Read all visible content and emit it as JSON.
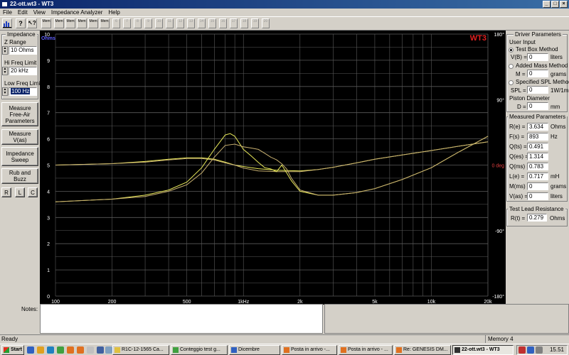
{
  "window": {
    "title": "22-ott.wt3 - WT3"
  },
  "menu": [
    "File",
    "Edit",
    "View",
    "Impedance Analyzer",
    "Help"
  ],
  "toolbar": {
    "buttons": [
      "chart-icon",
      "help-icon",
      "whats-this-icon",
      "Mem",
      "Mem",
      "Mem",
      "Mem",
      "Mem",
      "Peak",
      "Mem"
    ],
    "mem_numbers": [
      "1",
      "2",
      "3",
      "4",
      "5",
      "6",
      "7",
      "8",
      "9",
      "10",
      "11",
      "12",
      "13",
      "14",
      "15",
      "16",
      "17",
      "18",
      "19",
      "20"
    ]
  },
  "left_panel": {
    "impedance_group": "Impedance",
    "z_range_label": "Z Range",
    "z_range_value": "10 Ohms",
    "hi_freq_label": "Hi Freq Limit",
    "hi_freq_value": "20 kHz",
    "low_freq_label": "Low Freq Limit",
    "low_freq_value": "100 Hz",
    "measure_free_air": "Measure Free-Air Parameters",
    "measure_vas": "Measure V(as)",
    "impedance_sweep": "Impedance Sweep",
    "rub_and_buzz": "Rub and Buzz",
    "channel_buttons": [
      "R",
      "L",
      "C"
    ]
  },
  "graph": {
    "brand": "WT3",
    "y_unit": "Ohms",
    "y_ticks": [
      "10",
      "9",
      "8",
      "7",
      "6",
      "5",
      "4",
      "3",
      "2",
      "1",
      "0"
    ],
    "phase_ticks": [
      "180°",
      "90°",
      "0 deg",
      "-90°",
      "-180°"
    ],
    "x_ticks": [
      "100",
      "200",
      "500",
      "1kHz",
      "2k",
      "5k",
      "10k",
      "20k"
    ],
    "colors": {
      "background": "#000000",
      "grid": "#5a5a5a",
      "curve": "#e8e85a",
      "curve2": "#c8b070",
      "brand": "#e02020"
    }
  },
  "chart_data": {
    "type": "line",
    "x_scale": "log",
    "xlim": [
      100,
      20000
    ],
    "ylim": [
      0,
      10
    ],
    "y2lim": [
      -180,
      180
    ],
    "series": [
      {
        "x": [
          100,
          200,
          300,
          400,
          500,
          600,
          700,
          800,
          850,
          900,
          1000,
          1100,
          1200,
          1300,
          1400,
          1500,
          1600,
          1700,
          1800,
          2000,
          2500,
          3000,
          4000,
          5000,
          7000,
          10000,
          14000,
          20000
        ],
        "y": [
          3.6,
          3.7,
          3.85,
          4.05,
          4.35,
          4.9,
          5.6,
          6.15,
          6.2,
          6.1,
          5.6,
          5.35,
          5.1,
          4.9,
          4.85,
          4.75,
          5.0,
          4.7,
          4.4,
          4.0,
          3.85,
          3.85,
          3.95,
          4.1,
          4.45,
          4.9,
          5.5,
          6.1
        ]
      },
      {
        "x": [
          100,
          200,
          300,
          400,
          500,
          600,
          700,
          800,
          900,
          1000,
          1100,
          1200,
          1300,
          1400,
          1500,
          1600,
          1700,
          1800,
          2000,
          2500,
          3000,
          4000,
          5000,
          7000,
          10000,
          14000,
          20000
        ],
        "y": [
          3.6,
          3.7,
          3.8,
          4.0,
          4.25,
          4.7,
          5.3,
          5.75,
          5.8,
          5.7,
          5.65,
          5.6,
          5.45,
          5.3,
          5.2,
          5.05,
          4.85,
          4.5,
          4.05,
          3.85,
          3.85,
          3.95,
          4.1,
          4.45,
          4.9,
          5.5,
          6.1
        ]
      }
    ],
    "phase_series": [
      {
        "x": [
          100,
          200,
          300,
          400,
          500,
          600,
          700,
          800,
          900,
          1000,
          1200,
          1500,
          2000,
          2500,
          3000,
          4000,
          5000,
          7000,
          10000,
          14000,
          20000
        ],
        "y": [
          0,
          2,
          5,
          8,
          10,
          10,
          8,
          4,
          0,
          -2,
          -5,
          -7,
          -8,
          -6,
          -3,
          3,
          8,
          14,
          20,
          26,
          32
        ]
      },
      {
        "x": [
          100,
          200,
          300,
          400,
          500,
          600,
          700,
          800,
          900,
          1000,
          1200,
          1500,
          2000,
          2500,
          3000,
          4000,
          5000,
          7000,
          10000,
          14000,
          20000
        ],
        "y": [
          0,
          2,
          4,
          7,
          9,
          9,
          7,
          3,
          0,
          -4,
          -8,
          -9,
          -9,
          -6,
          -3,
          3,
          8,
          14,
          20,
          26,
          32
        ]
      }
    ]
  },
  "right_panel": {
    "driver_params_title": "Driver Parameters",
    "user_input_title": "User Input",
    "test_box_method": "Test Box Method",
    "vb_label": "V(B) =",
    "vb_value": "0",
    "vb_unit": "liters",
    "added_mass_method": "Added Mass Method",
    "m_label": "M =",
    "m_value": "0",
    "m_unit": "grams",
    "specified_spl_method": "Specified SPL Method",
    "spl_label": "SPL =",
    "spl_value": "0",
    "spl_unit": "1W/1m",
    "piston_diameter": "Piston Diameter",
    "d_label": "D =",
    "d_value": "0",
    "d_unit": "mm",
    "measured_title": "Measured Parameters",
    "measured": [
      {
        "label": "R(e) =",
        "value": "3.634",
        "unit": "Ohms"
      },
      {
        "label": "F(s) =",
        "value": "893",
        "unit": "Hz"
      },
      {
        "label": "Q(ts) =",
        "value": "0.491",
        "unit": ""
      },
      {
        "label": "Q(es) =",
        "value": "1.314",
        "unit": ""
      },
      {
        "label": "Q(ms) =",
        "value": "0.783",
        "unit": ""
      },
      {
        "label": "L(e) =",
        "value": "0.717",
        "unit": "mH"
      },
      {
        "label": "M(ms) =",
        "value": "0",
        "unit": "grams"
      },
      {
        "label": "V(as) =",
        "value": "0",
        "unit": "liters"
      }
    ],
    "lead_title": "Test Lead Resistance",
    "lead_label": "R(t) =",
    "lead_value": "0.279",
    "lead_unit": "Ohms"
  },
  "notes_label": "Notes:",
  "status": {
    "left": "Ready",
    "memory": "Memory 4"
  },
  "taskbar": {
    "start": "Start",
    "tasks": [
      "R1C-12-1565 Ca...",
      "Conteggio test g...",
      "Dicembre",
      "Posta in arrivo -...",
      "Posta in arrivo - ...",
      "Re: GENESIS DM...",
      "22-ott.wt3 - WT3"
    ],
    "clock": "15.51"
  }
}
